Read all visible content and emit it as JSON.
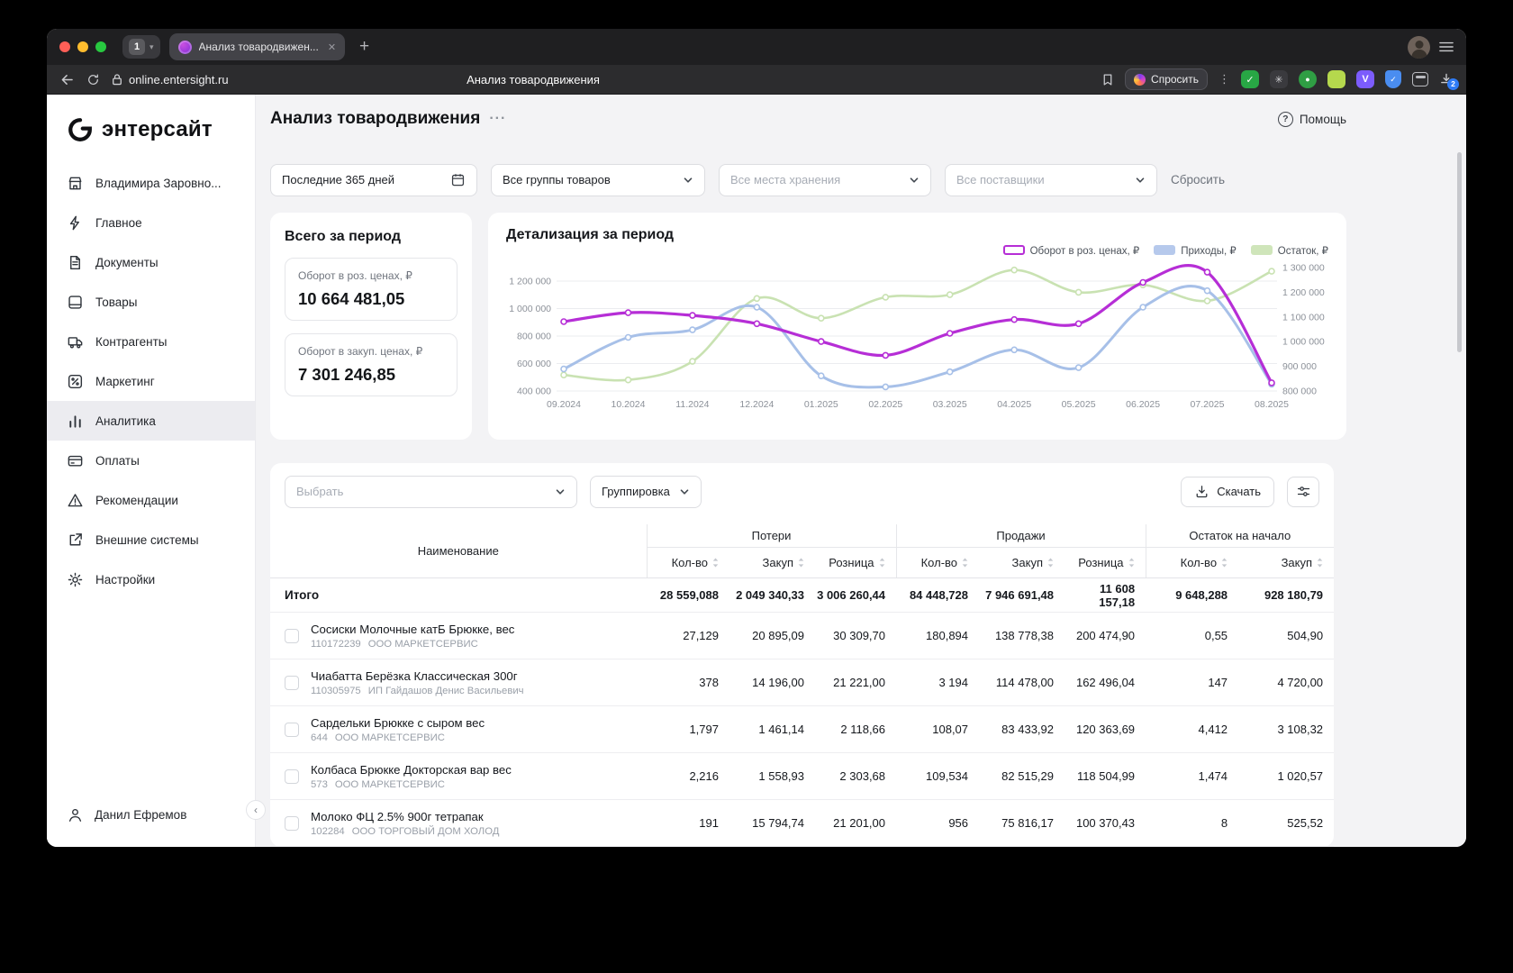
{
  "browser": {
    "tab_count": "1",
    "active_tab_title": "Анализ товародвижен...",
    "url": "online.entersight.ru",
    "page_title": "Анализ товародвижения",
    "ask_label": "Спросить",
    "downloads_badge": "2"
  },
  "sidebar": {
    "logo_text": "энтерсайт",
    "items": [
      {
        "label": "Владимира Заровно...",
        "icon": "store",
        "active": false
      },
      {
        "label": "Главное",
        "icon": "lightning",
        "active": false
      },
      {
        "label": "Документы",
        "icon": "document",
        "active": false
      },
      {
        "label": "Товары",
        "icon": "box",
        "active": false
      },
      {
        "label": "Контрагенты",
        "icon": "truck",
        "active": false
      },
      {
        "label": "Маркетинг",
        "icon": "percent",
        "active": false
      },
      {
        "label": "Аналитика",
        "icon": "bar-chart",
        "active": true
      },
      {
        "label": "Оплаты",
        "icon": "card",
        "active": false
      },
      {
        "label": "Рекомендации",
        "icon": "warning",
        "active": false
      },
      {
        "label": "Внешние системы",
        "icon": "external",
        "active": false
      },
      {
        "label": "Настройки",
        "icon": "gear",
        "active": false
      }
    ],
    "user_name": "Данил Ефремов"
  },
  "page": {
    "title": "Анализ товародвижения",
    "title_dots": "···",
    "help_label": "Помощь"
  },
  "filters": {
    "period_value": "Последние 365 дней",
    "group_value": "Все группы товаров",
    "storage_placeholder": "Все места хранения",
    "supplier_placeholder": "Все поставщики",
    "reset_label": "Сбросить"
  },
  "summary": {
    "title": "Всего за период",
    "stats": [
      {
        "label": "Оборот в роз. ценах, ₽",
        "value": "10 664 481,05"
      },
      {
        "label": "Оборот в закуп. ценах, ₽",
        "value": "7 301 246,85"
      }
    ]
  },
  "chart_data": {
    "type": "line",
    "title": "Детализация за период",
    "grid": true,
    "legend_position": "top-right",
    "x": [
      "09.2024",
      "10.2024",
      "11.2024",
      "12.2024",
      "01.2025",
      "02.2025",
      "03.2025",
      "04.2025",
      "05.2025",
      "06.2025",
      "07.2025",
      "08.2025"
    ],
    "left_axis": {
      "min": 400000,
      "max": 1200000,
      "tick_values": [
        1200000,
        1000000,
        800000,
        600000,
        400000
      ],
      "tick_labels": [
        "1 200 000",
        "1 000 000",
        "800 000",
        "600 000",
        "400 000"
      ]
    },
    "right_axis": {
      "min": 800000,
      "max": 1300000,
      "tick_values": [
        1300000,
        1200000,
        1100000,
        1000000,
        900000,
        800000
      ],
      "tick_labels": [
        "1 300 000",
        "1 200 000",
        "1 100 000",
        "1 000 000",
        "900 000",
        "800 000"
      ]
    },
    "series": [
      {
        "name": "Оборот в роз. ценах, ₽",
        "axis": "left",
        "color": "#b62ed6",
        "swatch": "outline",
        "values": [
          905000,
          970000,
          950000,
          890000,
          760000,
          660000,
          820000,
          920000,
          890000,
          1190000,
          1265000,
          460000
        ]
      },
      {
        "name": "Приходы, ₽",
        "axis": "left",
        "color": "#a7c0e8",
        "swatch": "fill",
        "fill": "#b6c9ec",
        "values": [
          560000,
          790000,
          845000,
          1010000,
          510000,
          430000,
          540000,
          700000,
          570000,
          1010000,
          1130000,
          450000
        ]
      },
      {
        "name": "Остаток, ₽",
        "axis": "right",
        "color": "#c9e2b2",
        "swatch": "fill",
        "fill": "#cfe5ba",
        "values": [
          865000,
          845000,
          920000,
          1175000,
          1095000,
          1180000,
          1190000,
          1290000,
          1200000,
          1230000,
          1165000,
          1285000
        ]
      }
    ]
  },
  "table": {
    "select_placeholder": "Выбрать",
    "grouping_label": "Группировка",
    "download_label": "Скачать",
    "name_header": "Наименование",
    "groups": [
      {
        "label": "Потери",
        "cols": [
          "Кол-во",
          "Закуп",
          "Розница"
        ]
      },
      {
        "label": "Продажи",
        "cols": [
          "Кол-во",
          "Закуп",
          "Розница"
        ]
      },
      {
        "label": "Остаток на начало",
        "cols": [
          "Кол-во",
          "Закуп"
        ]
      }
    ],
    "total": {
      "label": "Итого",
      "values": [
        "28 559,088",
        "2 049 340,33",
        "3 006 260,44",
        "84 448,728",
        "7 946 691,48",
        "11 608 157,18",
        "9 648,288",
        "928 180,79"
      ]
    },
    "rows": [
      {
        "name": "Сосиски Молочные катБ Брюкке, вес",
        "code": "110172239",
        "supplier": "ООО МАРКЕТСЕРВИС",
        "values": [
          "27,129",
          "20 895,09",
          "30 309,70",
          "180,894",
          "138 778,38",
          "200 474,90",
          "0,55",
          "504,90"
        ]
      },
      {
        "name": "Чиабатта Берёзка Классическая 300г",
        "code": "110305975",
        "supplier": "ИП Гайдашов Денис Васильевич",
        "values": [
          "378",
          "14 196,00",
          "21 221,00",
          "3 194",
          "114 478,00",
          "162 496,04",
          "147",
          "4 720,00"
        ]
      },
      {
        "name": "Сардельки Брюкке с сыром вес",
        "code": "644",
        "supplier": "ООО МАРКЕТСЕРВИС",
        "values": [
          "1,797",
          "1 461,14",
          "2 118,66",
          "108,07",
          "83 433,92",
          "120 363,69",
          "4,412",
          "3 108,32"
        ]
      },
      {
        "name": "Колбаса Брюкке Докторская вар вес",
        "code": "573",
        "supplier": "ООО МАРКЕТСЕРВИС",
        "values": [
          "2,216",
          "1 558,93",
          "2 303,68",
          "109,534",
          "82 515,29",
          "118 504,99",
          "1,474",
          "1 020,57"
        ]
      },
      {
        "name": "Молоко ФЦ 2.5% 900г тетрапак",
        "code": "102284",
        "supplier": "ООО ТОРГОВЫЙ ДОМ ХОЛОД",
        "values": [
          "191",
          "15 794,74",
          "21 201,00",
          "956",
          "75 816,17",
          "100 370,43",
          "8",
          "525,52"
        ]
      }
    ]
  }
}
